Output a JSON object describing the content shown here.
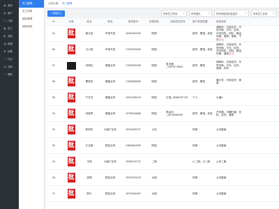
{
  "rail": [
    {
      "icon": "user-icon",
      "glyph": "▣",
      "label": "首页"
    },
    {
      "icon": "clipboard-icon",
      "glyph": "▤",
      "label": "客户"
    },
    {
      "icon": "chart-icon",
      "glyph": "◫",
      "label": "订单"
    },
    {
      "icon": "users-icon",
      "glyph": "▦",
      "label": "员工"
    },
    {
      "icon": "bell-icon",
      "glyph": "◧",
      "label": "消息"
    },
    {
      "icon": "shield-icon",
      "glyph": "◨",
      "label": "权限"
    },
    {
      "icon": "gear-icon",
      "glyph": "✱",
      "label": "设置"
    },
    {
      "icon": "list-icon",
      "glyph": "≡",
      "label": "日志"
    },
    {
      "icon": "box-icon",
      "glyph": "▥",
      "label": "仓库"
    },
    {
      "icon": "help-icon",
      "glyph": "?",
      "label": "帮助"
    }
  ],
  "submenu": [
    {
      "label": "员工管理",
      "active": true
    },
    {
      "label": "员工列表",
      "active": false
    },
    {
      "label": "团队管理",
      "active": false
    },
    {
      "label": "团队架构",
      "active": false
    }
  ],
  "breadcrumb": {
    "prefix": "当前位置：",
    "current": "员工管理"
  },
  "toolbar": {
    "add_label": "+ 添加员工",
    "filters": [
      "所有员工职务",
      "所有团队",
      "所有销售团队配送员",
      "所有员工状态"
    ]
  },
  "columns": [
    "ID",
    "头像",
    "姓名",
    "职务",
    "登录账号",
    "所属团队",
    "绑定配送员号",
    "客户类型配置",
    "绑定资质"
  ],
  "rows": [
    {
      "id": "61",
      "avatar": "seal",
      "name": "黄元浩",
      "title": "市场开发",
      "phone": "15443487040",
      "team": "陈团",
      "courier": "",
      "customer": "超市、餐馆、批发",
      "qual": "调味料、日用百货、牙膏牙刷、冷冻、百货、冷冻饮料、饮料、粮油米面、酒类、速食、干货",
      "qual_red": "(1/1)"
    },
    {
      "id": "60",
      "avatar": "seal",
      "name": "王小英",
      "title": "市场开发",
      "phone": "17515230000",
      "team": "陈团",
      "courier": "",
      "customer": "超市、餐馆、批发",
      "qual": "调味料、日用百货、牙膏牙刷、冷冻、百货、冷冻饮料、饮料、粮油米面、酒类",
      "qual_red": "(1/1)"
    },
    {
      "id": "57",
      "avatar": "photo",
      "name": "刘明达",
      "title": "渠道业务",
      "phone": "17833332238",
      "team": "陈团",
      "courier": "鲁交通_13578774843",
      "customer": "超市、餐馆",
      "qual": "调味料、日用百货、牙膏牙刷、冷冻、百货、速食、饮料",
      "qual_red": ""
    },
    {
      "id": "56",
      "avatar": "seal",
      "name": "曹俊杰",
      "title": "渠道业务",
      "phone": "17853866069",
      "team": "陈团",
      "courier": "",
      "customer": "超市、餐馆",
      "qual": "通义关、日用百货、速食",
      "qual_red": ""
    },
    {
      "id": "55",
      "avatar": "seal",
      "name": "于艺洋",
      "title": "渠道业务",
      "phone": "13314150478",
      "team": "陈团",
      "courier": "王瑞_18966787725",
      "customer": "个人",
      "qual": "大福#",
      "qual_red": ""
    },
    {
      "id": "53",
      "avatar": "seal",
      "name": "何俊誉",
      "title": "渠道业务",
      "phone": "13756184688",
      "team": "陈团",
      "courier": "再会刘_18743066295",
      "customer": "超市、餐馆、批发",
      "qual": "汽车箱、冷藏贮藏、饮料、百货、速食",
      "qual_red": ""
    },
    {
      "id": "52",
      "avatar": "seal",
      "name": "陈柯华",
      "title": "大客户业务",
      "phone": "15764495737",
      "team": "公司",
      "courier": "",
      "customer": "特殊",
      "qual": "公司直营",
      "qual_red": ""
    },
    {
      "id": "50",
      "avatar": "seal",
      "name": "王旦超",
      "title": "配送业务",
      "phone": "13864824250",
      "team": "陈团",
      "courier": "",
      "customer": "特殊",
      "qual": "公司直营",
      "qual_red": ""
    },
    {
      "id": "49",
      "avatar": "seal",
      "name": "王莉",
      "title": "大客户业务",
      "phone": "15948742711",
      "team": "二团",
      "courier": "",
      "customer": "小二团、大二团",
      "qual": "公司二团",
      "qual_red": ""
    },
    {
      "id": "48",
      "avatar": "seal",
      "name": "滋丽",
      "title": "配送业务",
      "phone": "15332310243",
      "team": "大团",
      "courier": "",
      "customer": "特殊",
      "qual": "公司直营",
      "qual_red": ""
    },
    {
      "id": "47",
      "avatar": "seal",
      "name": "陈乐",
      "title": "配送业务",
      "phone": "18704440487",
      "team": "大团",
      "courier": "",
      "customer": "特殊",
      "qual": "公司直营",
      "qual_red": ""
    }
  ]
}
